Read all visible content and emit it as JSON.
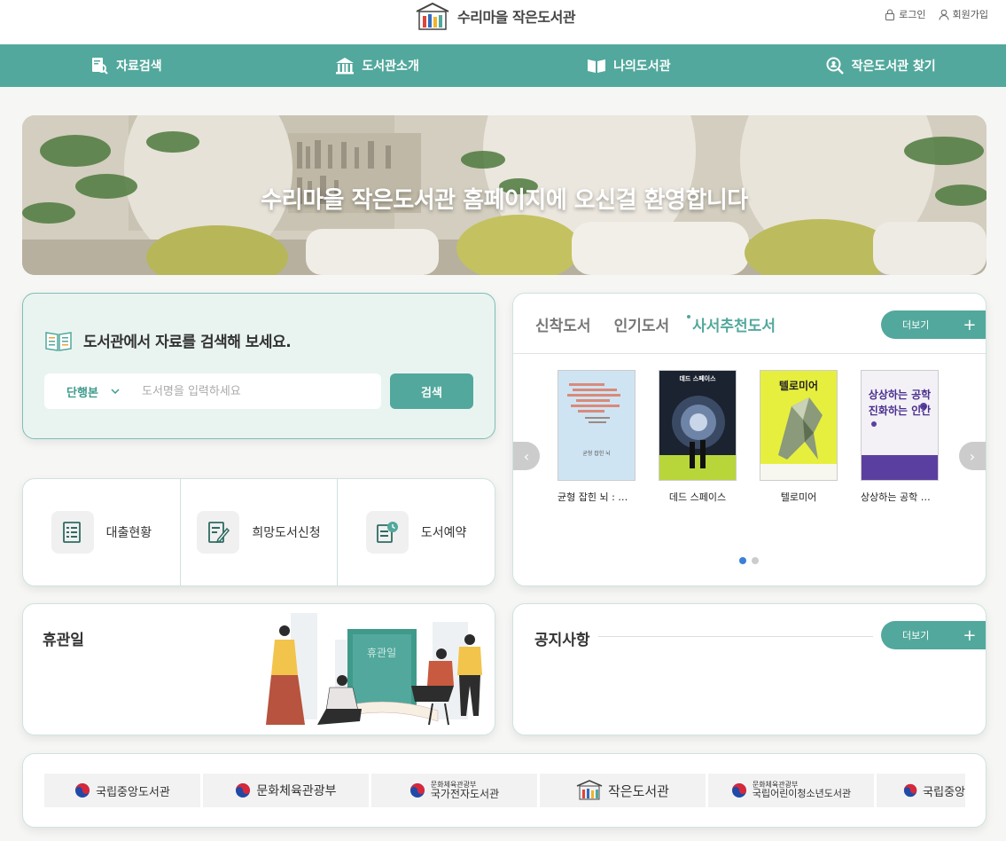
{
  "header": {
    "logo_text": "수리마을 작은도서관",
    "login_label": "로그인",
    "signup_label": "회원가입"
  },
  "nav": {
    "items": [
      {
        "label": "자료검색",
        "icon": "search-document-icon"
      },
      {
        "label": "도서관소개",
        "icon": "library-building-icon"
      },
      {
        "label": "나의도서관",
        "icon": "open-book-icon"
      },
      {
        "label": "작은도서관 찾기",
        "icon": "magnifier-location-icon"
      }
    ]
  },
  "hero": {
    "title": "수리마을 작은도서관 홈페이지에 오신걸 환영합니다"
  },
  "search": {
    "title": "도서관에서 자료를 검색해 보세요.",
    "type_selected": "단행본",
    "placeholder": "도서명을 입력하세요",
    "button_label": "검색"
  },
  "quick_menu": {
    "items": [
      {
        "label": "대출현황",
        "icon": "loan-list-icon"
      },
      {
        "label": "희망도서신청",
        "icon": "book-request-icon"
      },
      {
        "label": "도서예약",
        "icon": "reservation-clock-icon"
      }
    ]
  },
  "books": {
    "tabs": [
      {
        "label": "신착도서"
      },
      {
        "label": "인기도서"
      },
      {
        "label": "사서추천도서"
      }
    ],
    "more_label": "더보기",
    "items": [
      {
        "title": "균형 잡힌 뇌 : 인…",
        "cover_text": "균형 잡힌 뇌"
      },
      {
        "title": "데드 스페이스",
        "cover_text": "데드 스페이스"
      },
      {
        "title": "텔로미어",
        "cover_text": "텔로미어"
      },
      {
        "title": "상상하는 공학 진…",
        "cover_text": "상상하는 공학 진화하는 인간"
      }
    ],
    "prev_glyph": "‹",
    "next_glyph": "›"
  },
  "holiday": {
    "title": "휴관일",
    "art_text": "휴관일"
  },
  "notice": {
    "title": "공지사항",
    "more_label": "더보기"
  },
  "banners": {
    "items": [
      {
        "label": "국립중앙도서관"
      },
      {
        "label": "문화체육관광부"
      },
      {
        "sub": "문화체육관광부",
        "label": "국가전자도서관"
      },
      {
        "label": "작은도서관"
      },
      {
        "sub": "문화체육관광부",
        "label": "국립어린이청소년도서관"
      },
      {
        "label": "국립중앙"
      }
    ]
  },
  "colors": {
    "accent": "#52a89c",
    "search_bg": "#e9f4f1",
    "active_dot": "#3b7fd9"
  }
}
